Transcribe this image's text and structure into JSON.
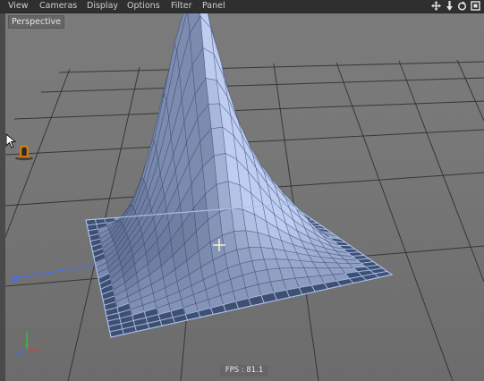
{
  "menu": {
    "items": [
      "View",
      "Cameras",
      "Display",
      "Options",
      "Filter",
      "Panel"
    ]
  },
  "nav_icons": [
    "move-view-icon",
    "dolly-view-icon",
    "rotate-view-icon",
    "toggle-view-icon"
  ],
  "viewport": {
    "label": "Perspective",
    "fps": "FPS : 81.1",
    "axis_colors": {
      "x": "#d24040",
      "y": "#3ec23e",
      "z": "#4a6cf0"
    },
    "mesh_color": "#a8c2ee",
    "mesh_wire_color": "#2b3f6b",
    "background_color": "#787878"
  }
}
